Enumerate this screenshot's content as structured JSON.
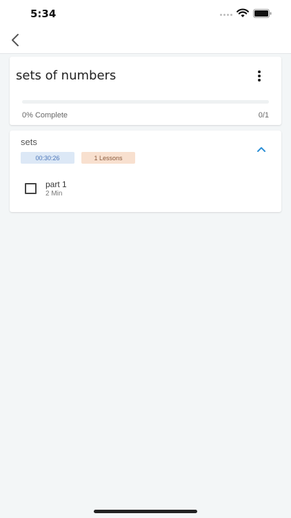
{
  "status_bar": {
    "time": "5:34",
    "signal_icon": "signal-dots-icon",
    "wifi_icon": "wifi-icon",
    "battery_icon": "battery-icon"
  },
  "nav": {
    "back_icon": "chevron-left-icon"
  },
  "course": {
    "title": "sets of numbers",
    "menu_icon": "more-vertical-icon",
    "progress_label": "0% Complete",
    "progress_count": "0/1",
    "progress_fraction": 0
  },
  "section": {
    "title": "sets",
    "duration": "00:30:26",
    "lessons_badge": "1 Lessons",
    "collapse_icon": "chevron-up-icon",
    "lessons": [
      {
        "title": "part 1",
        "meta": "2 Min",
        "checked": false
      }
    ]
  },
  "colors": {
    "background": "#f3f6f7",
    "accent": "#2b8fd6",
    "duration_chip_bg": "#dce8f6",
    "lessons_chip_bg": "#f8e0cf"
  }
}
